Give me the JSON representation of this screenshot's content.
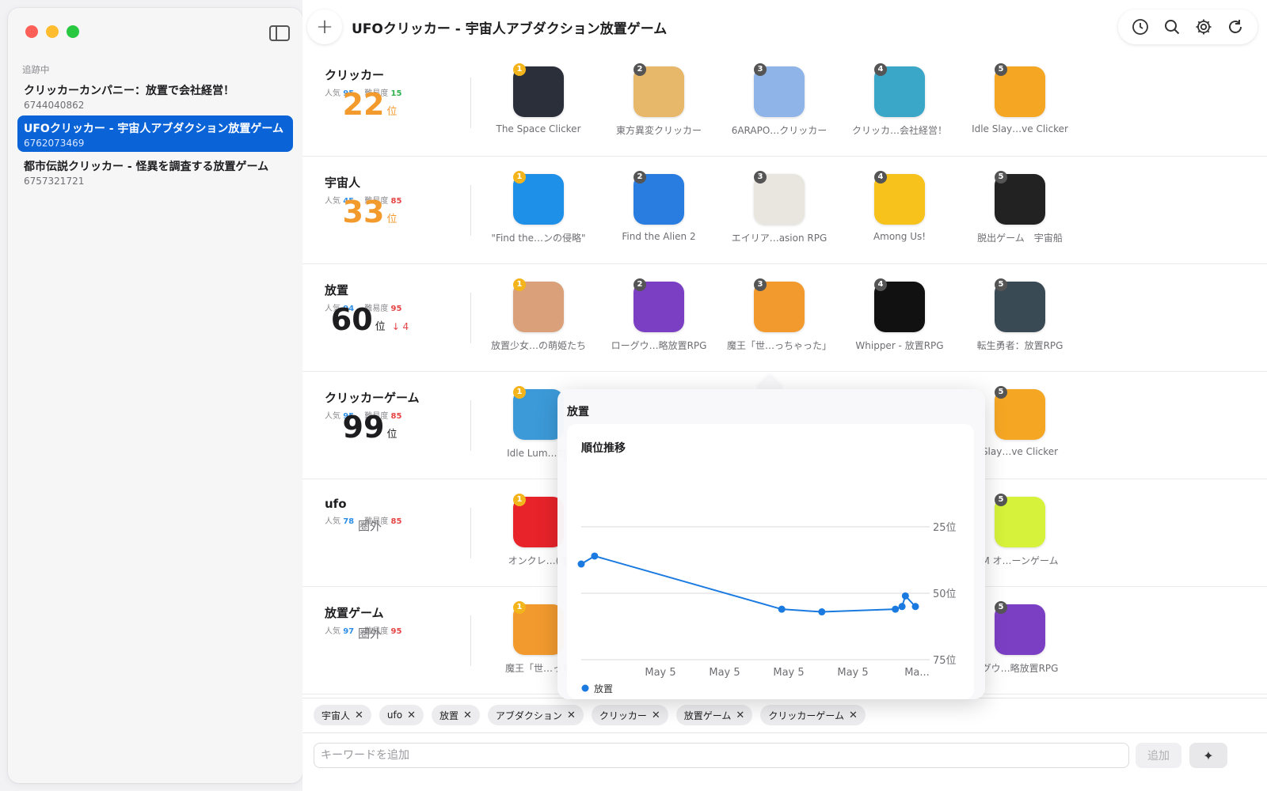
{
  "sidebar": {
    "section_label": "追跡中",
    "items": [
      {
        "name": "クリッカーカンパニー：放置で会社経営！",
        "id": "6744040862",
        "active": false
      },
      {
        "name": "UFOクリッカー - 宇宙人アブダクション放置ゲーム",
        "id": "6762073469",
        "active": true
      },
      {
        "name": "都市伝説クリッカー - 怪異を調査する放置ゲーム",
        "id": "6757321721",
        "active": false
      }
    ]
  },
  "toolbar": {
    "add_icon": "plus-icon",
    "title": "UFOクリッカー - 宇宙人アブダクション放置ゲーム",
    "icons": [
      "history-icon",
      "search-icon",
      "gear-icon",
      "refresh-icon"
    ]
  },
  "labels": {
    "popularity": "人気",
    "difficulty": "難易度",
    "rank_unit": "位",
    "outside": "圏外"
  },
  "keywords": [
    {
      "name": "クリッカー",
      "popularity": "95",
      "difficulty": "15",
      "rank": "22",
      "delta": "",
      "highlight": true,
      "apps": [
        {
          "rank": "1",
          "name": "The Space Clicker",
          "color": "#2b2f3a"
        },
        {
          "rank": "2",
          "name": "東方異変クリッカー",
          "color": "#e8b86a"
        },
        {
          "rank": "3",
          "name": "6ARAPO…クリッカー",
          "color": "#8fb4e8"
        },
        {
          "rank": "4",
          "name": "クリッカ…会社経営！",
          "color": "#3aa6c8"
        },
        {
          "rank": "5",
          "name": "Idle Slay…ve Clicker",
          "color": "#f5a623"
        }
      ]
    },
    {
      "name": "宇宙人",
      "popularity": "45",
      "difficulty": "85",
      "rank": "33",
      "delta": "",
      "highlight": true,
      "apps": [
        {
          "rank": "1",
          "name": "\"Find the…ンの侵略\"",
          "color": "#1e90e8"
        },
        {
          "rank": "2",
          "name": "Find the Alien 2",
          "color": "#2a7de0"
        },
        {
          "rank": "3",
          "name": "エイリア…asion RPG",
          "color": "#e9e6df"
        },
        {
          "rank": "4",
          "name": "Among Us!",
          "color": "#f7c21b"
        },
        {
          "rank": "5",
          "name": "脱出ゲーム　宇宙船",
          "color": "#222222"
        }
      ]
    },
    {
      "name": "放置",
      "popularity": "94",
      "difficulty": "95",
      "rank": "60",
      "delta": "↓ 4",
      "highlight": false,
      "apps": [
        {
          "rank": "1",
          "name": "放置少女…の萌姫たち",
          "color": "#d9a07a"
        },
        {
          "rank": "2",
          "name": "ローグウ…略放置RPG",
          "color": "#7b3fc4"
        },
        {
          "rank": "3",
          "name": "魔王「世…っちゃった」",
          "color": "#f29a2e"
        },
        {
          "rank": "4",
          "name": "Whipper - 放置RPG",
          "color": "#111111"
        },
        {
          "rank": "5",
          "name": "転生勇者：放置RPG",
          "color": "#3a4a55"
        }
      ]
    },
    {
      "name": "クリッカーゲーム",
      "popularity": "95",
      "difficulty": "85",
      "rank": "99",
      "delta": "",
      "highlight": false,
      "apps": [
        {
          "rank": "1",
          "name": "Idle Lum…カ-",
          "color": "#3c9ad8"
        },
        {
          "rank": "",
          "name": "",
          "color": ""
        },
        {
          "rank": "",
          "name": "",
          "color": ""
        },
        {
          "rank": "",
          "name": "",
          "color": ""
        },
        {
          "rank": "5",
          "name": "Slay…ve Clicker",
          "color": "#f5a623"
        }
      ]
    },
    {
      "name": "ufo",
      "popularity": "78",
      "difficulty": "85",
      "rank": "",
      "delta": "",
      "highlight": false,
      "apps": [
        {
          "rank": "1",
          "name": "オンクレ…(オ",
          "color": "#e8232a"
        },
        {
          "rank": "",
          "name": "",
          "color": ""
        },
        {
          "rank": "",
          "name": "",
          "color": ""
        },
        {
          "rank": "",
          "name": "",
          "color": ""
        },
        {
          "rank": "5",
          "name": "M オ…ーンゲーム",
          "color": "#d6f23a"
        }
      ]
    },
    {
      "name": "放置ゲーム",
      "popularity": "97",
      "difficulty": "95",
      "rank": "",
      "delta": "",
      "highlight": false,
      "apps": [
        {
          "rank": "1",
          "name": "魔王「世…っち",
          "color": "#f29a2e"
        },
        {
          "rank": "",
          "name": "",
          "color": ""
        },
        {
          "rank": "",
          "name": "",
          "color": ""
        },
        {
          "rank": "",
          "name": "",
          "color": ""
        },
        {
          "rank": "5",
          "name": "グウ…略放置RPG",
          "color": "#7b3fc4"
        }
      ]
    }
  ],
  "popover": {
    "title": "放置",
    "subtitle": "順位推移",
    "legend": "放置",
    "color": "#1a7ae0"
  },
  "chart_data": {
    "type": "line",
    "title": "順位推移",
    "series": [
      {
        "name": "放置",
        "points": [
          {
            "x": 0.0,
            "y": 39
          },
          {
            "x": 0.04,
            "y": 36
          },
          {
            "x": 0.6,
            "y": 56
          },
          {
            "x": 0.72,
            "y": 57
          },
          {
            "x": 0.94,
            "y": 56
          },
          {
            "x": 0.96,
            "y": 55
          },
          {
            "x": 0.97,
            "y": 51
          },
          {
            "x": 1.0,
            "y": 55
          }
        ]
      }
    ],
    "x_tick_labels": [
      "May 5",
      "May 5",
      "May 5",
      "May 5",
      "Ma..."
    ],
    "y_ticks": [
      {
        "value": 25,
        "label": "25位"
      },
      {
        "value": 50,
        "label": "50位"
      },
      {
        "value": 75,
        "label": "75位"
      }
    ],
    "ylim": [
      75,
      25
    ],
    "y_inverted": true,
    "grid": true,
    "legend_position": "bottom-left"
  },
  "chips": [
    "宇宙人",
    "ufo",
    "放置",
    "アブダクション",
    "クリッカー",
    "放置ゲーム",
    "クリッカーゲーム"
  ],
  "input": {
    "placeholder": "キーワードを追加",
    "add_label": "追加",
    "sparkle_icon": "sparkle-icon"
  }
}
